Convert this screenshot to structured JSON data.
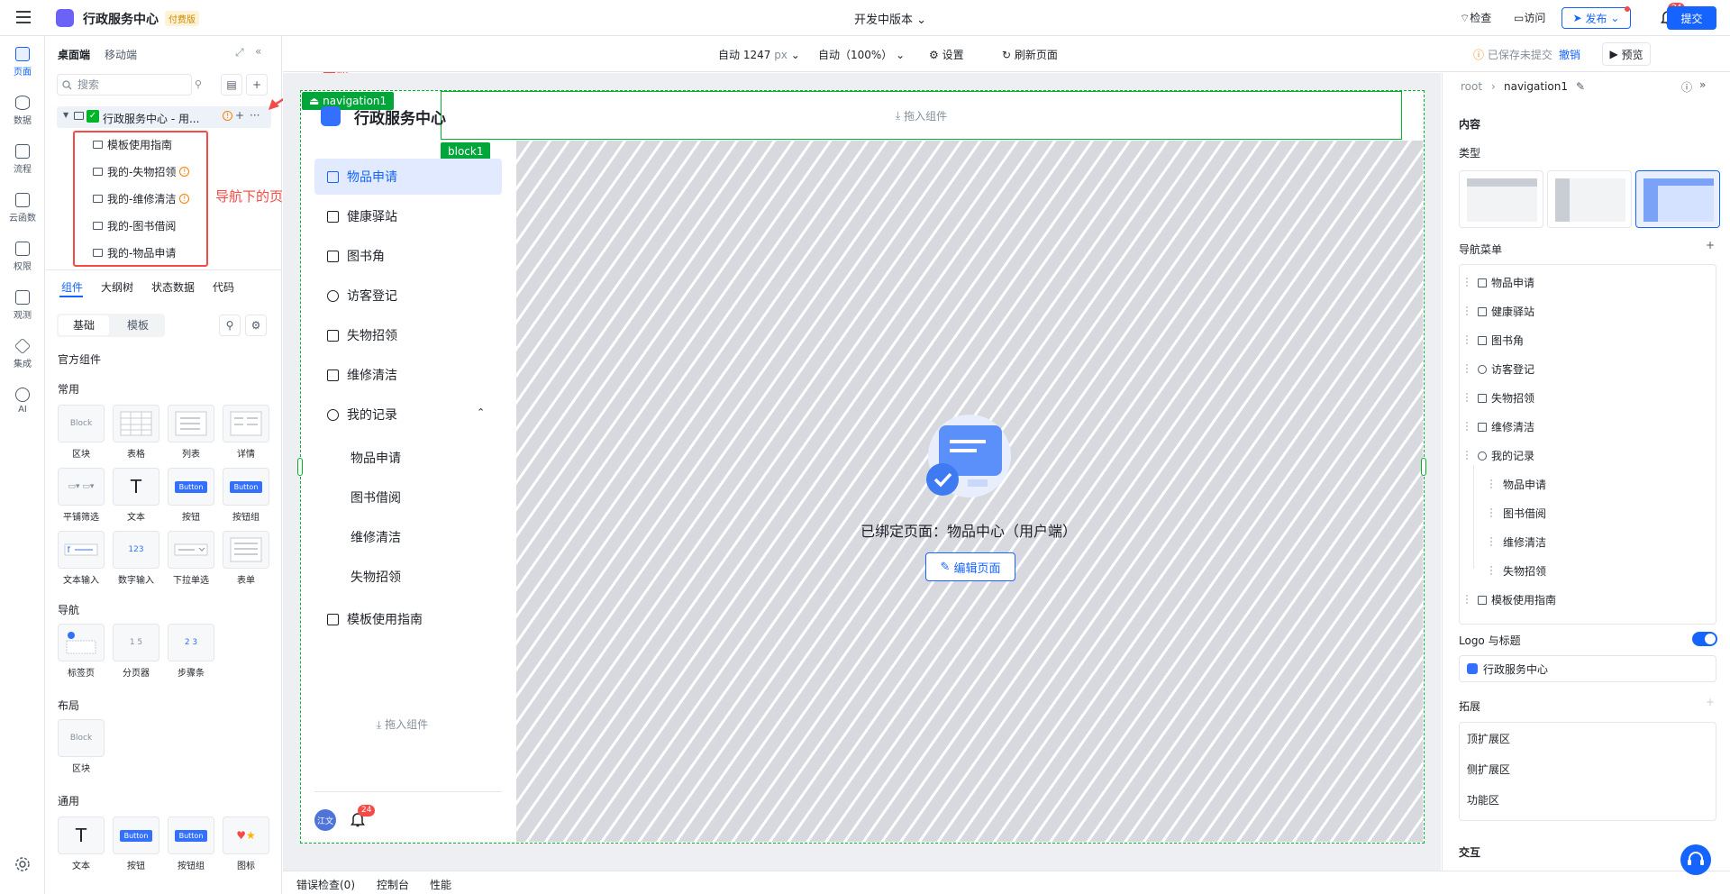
{
  "app": {
    "title": "行政服务中心",
    "paid_badge": "付费版",
    "version": "开发中版本",
    "check": "检查",
    "visit": "访问",
    "publish": "发布",
    "notify_count": "24",
    "user": "江文"
  },
  "rail": [
    {
      "label": "页面",
      "icon": "page-icon",
      "active": true
    },
    {
      "label": "数据",
      "icon": "database-icon"
    },
    {
      "label": "流程",
      "icon": "flow-icon"
    },
    {
      "label": "云函数",
      "icon": "code-icon"
    },
    {
      "label": "权限",
      "icon": "lock-icon"
    },
    {
      "label": "观测",
      "icon": "monitor-icon"
    },
    {
      "label": "集成",
      "icon": "cube-icon"
    },
    {
      "label": "AI",
      "icon": "ai-icon"
    }
  ],
  "left_panel": {
    "tabs": [
      "桌面端",
      "移动端"
    ],
    "search_placeholder": "搜索",
    "tree_root": "行政服务中心 - 用...",
    "tree_children": [
      "模板使用指南",
      "我的-失物招领",
      "我的-维修清洁",
      "我的-图书借阅",
      "我的-物品申请"
    ],
    "annotation_nav": "导航",
    "annotation_pages": "导航下的页面",
    "sub_tabs": [
      "组件",
      "大纲树",
      "状态数据",
      "代码"
    ],
    "segment": [
      "基础",
      "模板"
    ],
    "official": "官方组件",
    "sections": {
      "common": "常用",
      "nav": "导航",
      "layout": "布局",
      "general": "通用"
    },
    "common_items": [
      "区块",
      "表格",
      "列表",
      "详情",
      "平铺筛选",
      "文本",
      "按钮",
      "按钮组",
      "文本输入",
      "数字输入",
      "下拉单选",
      "表单"
    ],
    "nav_items": [
      "标签页",
      "分页器",
      "步骤条"
    ],
    "layout_items": [
      "区块"
    ],
    "general_items": [
      "文本",
      "按钮",
      "按钮组",
      "图标"
    ],
    "block_text": "Block",
    "button_text": "Button",
    "number_sample": "123",
    "pager_sample": "1  5",
    "step_sample": "2  3"
  },
  "canvas_toolbar": {
    "width": "自动 1247",
    "unit": "px",
    "zoom": "自动（100%）",
    "settings": "设置",
    "refresh": "刷新页面",
    "saved": "已保存未提交",
    "undo": "撤销",
    "preview": "预览",
    "submit": "提交"
  },
  "canvas": {
    "nav_tag": "navigation1",
    "block_tag": "block1",
    "drop_component": "拖入组件",
    "nav_title": "行政服务中心",
    "nav_items": [
      "物品申请",
      "健康驿站",
      "图书角",
      "访客登记",
      "失物招领",
      "维修清洁",
      "我的记录"
    ],
    "sub_items": [
      "物品申请",
      "图书借阅",
      "维修清洁",
      "失物招领"
    ],
    "last_item": "模板使用指南",
    "bound_page": "已绑定页面：物品中心（用户端）",
    "edit_page": "编辑页面",
    "nav_badge": "24"
  },
  "bottom_bar": [
    "错误检查(0)",
    "控制台",
    "性能"
  ],
  "right_panel": {
    "breadcrumb_root": "root",
    "breadcrumb_current": "navigation1",
    "content": "内容",
    "type": "类型",
    "nav_menu": "导航菜单",
    "menu_items": [
      "物品申请",
      "健康驿站",
      "图书角",
      "访客登记",
      "失物招领",
      "维修清洁",
      "我的记录"
    ],
    "menu_sub_items": [
      "物品申请",
      "图书借阅",
      "维修清洁",
      "失物招领"
    ],
    "menu_last": "模板使用指南",
    "logo_title": "Logo 与标题",
    "logo_value": "行政服务中心",
    "extend": "拓展",
    "extend_items": [
      "顶扩展区",
      "侧扩展区",
      "功能区"
    ],
    "interaction": "交互"
  },
  "colors": {
    "accent": "#1664ff",
    "selection_green": "#00b42a",
    "annotation_red": "#f54a45"
  }
}
